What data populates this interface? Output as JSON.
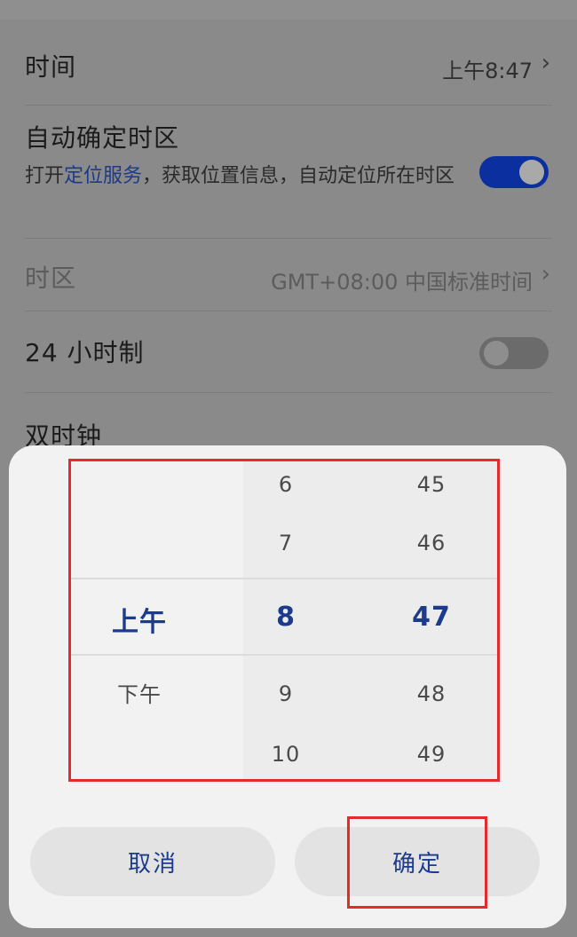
{
  "settings": {
    "time": {
      "title": "时间",
      "value": "上午8:47"
    },
    "auto_timezone": {
      "title": "自动确定时区",
      "sub_prefix": "打开",
      "sub_link": "定位服务",
      "sub_suffix": "，获取位置信息，自动定位所在时区",
      "enabled": true
    },
    "timezone": {
      "title": "时区",
      "value": "GMT+08:00 中国标准时间"
    },
    "hour24": {
      "title": "24 小时制",
      "enabled": false
    },
    "dual_clock": {
      "title": "双时钟"
    }
  },
  "picker": {
    "ampm": {
      "options": [
        "上午",
        "下午"
      ],
      "selected": "上午"
    },
    "hours": {
      "options": [
        "6",
        "7",
        "8",
        "9",
        "10"
      ],
      "selected": "8"
    },
    "minutes": {
      "options": [
        "45",
        "46",
        "47",
        "48",
        "49"
      ],
      "selected": "47"
    }
  },
  "buttons": {
    "cancel": "取消",
    "confirm": "确定"
  },
  "colors": {
    "accent": "#1c3a8e",
    "toggle_on": "#0b2f9e",
    "annotation_frame": "#e32b2b"
  }
}
